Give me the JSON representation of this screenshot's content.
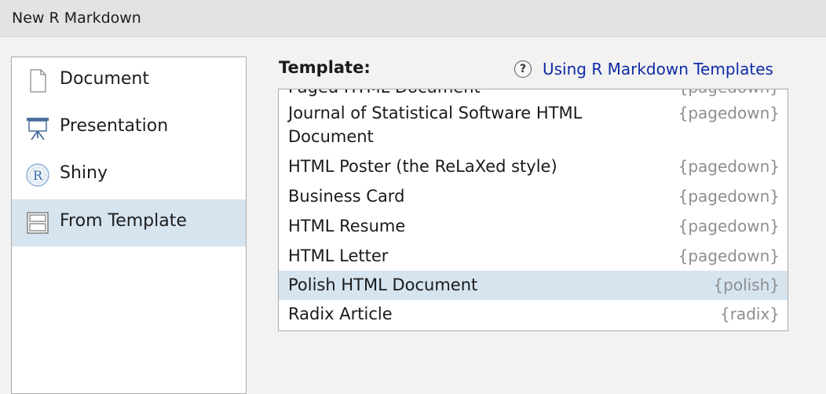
{
  "window": {
    "title": "New R Markdown"
  },
  "sidebar": {
    "items": [
      {
        "label": "Document",
        "icon": "document-icon"
      },
      {
        "label": "Presentation",
        "icon": "presentation-icon"
      },
      {
        "label": "Shiny",
        "icon": "shiny-icon"
      },
      {
        "label": "From Template",
        "icon": "template-icon",
        "selected": true
      }
    ]
  },
  "template": {
    "label": "Template:",
    "help_link": "Using R Markdown Templates",
    "help_icon": "?",
    "rows": [
      {
        "name": "Paged HTML Document",
        "pkg": "{pagedown}"
      },
      {
        "name": "Journal of Statistical Software HTML",
        "name2": "Document",
        "pkg": "{pagedown}"
      },
      {
        "name": "HTML Poster (the ReLaXed style)",
        "pkg": "{pagedown}"
      },
      {
        "name": "Business Card",
        "pkg": "{pagedown}"
      },
      {
        "name": "HTML Resume",
        "pkg": "{pagedown}"
      },
      {
        "name": "HTML Letter",
        "pkg": "{pagedown}"
      },
      {
        "name": "Polish HTML Document",
        "pkg": "{polish}",
        "selected": true
      },
      {
        "name": "Radix Article",
        "pkg": "{radix}"
      }
    ]
  },
  "colors": {
    "selection": "#d6e4f0",
    "link": "#0e2ba6",
    "package_text": "#8e8e8e"
  }
}
